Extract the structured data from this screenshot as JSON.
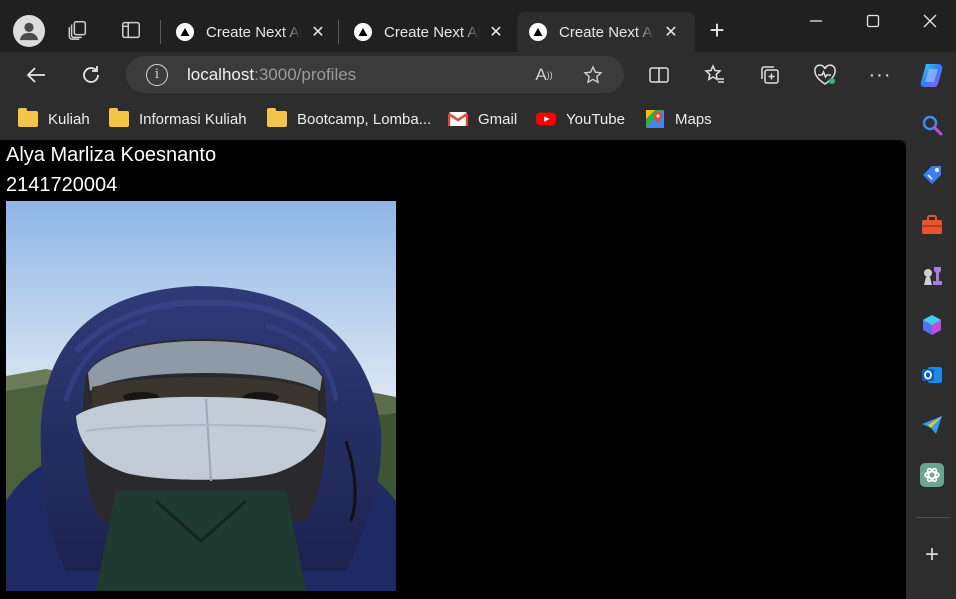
{
  "tabs": [
    {
      "title": "Create Next App",
      "active": false
    },
    {
      "title": "Create Next App",
      "active": false
    },
    {
      "title": "Create Next App",
      "active": true
    }
  ],
  "address_bar": {
    "host": "localhost",
    "path": ":3000/profiles"
  },
  "bookmarks": [
    {
      "label": "Kuliah",
      "icon": "folder-icon"
    },
    {
      "label": "Informasi Kuliah",
      "icon": "folder-icon"
    },
    {
      "label": "Bootcamp, Lomba...",
      "icon": "folder-icon"
    },
    {
      "label": "Gmail",
      "icon": "gmail-icon"
    },
    {
      "label": "YouTube",
      "icon": "youtube-icon"
    },
    {
      "label": "Maps",
      "icon": "maps-icon"
    }
  ],
  "page": {
    "name": "Alya Marliza Koesnanto",
    "nim": "2141720004"
  },
  "colors": {
    "chrome_dark": "#202020",
    "toolbar": "#2d2d2d",
    "page_background": "#000000",
    "page_text": "#ffffff"
  }
}
